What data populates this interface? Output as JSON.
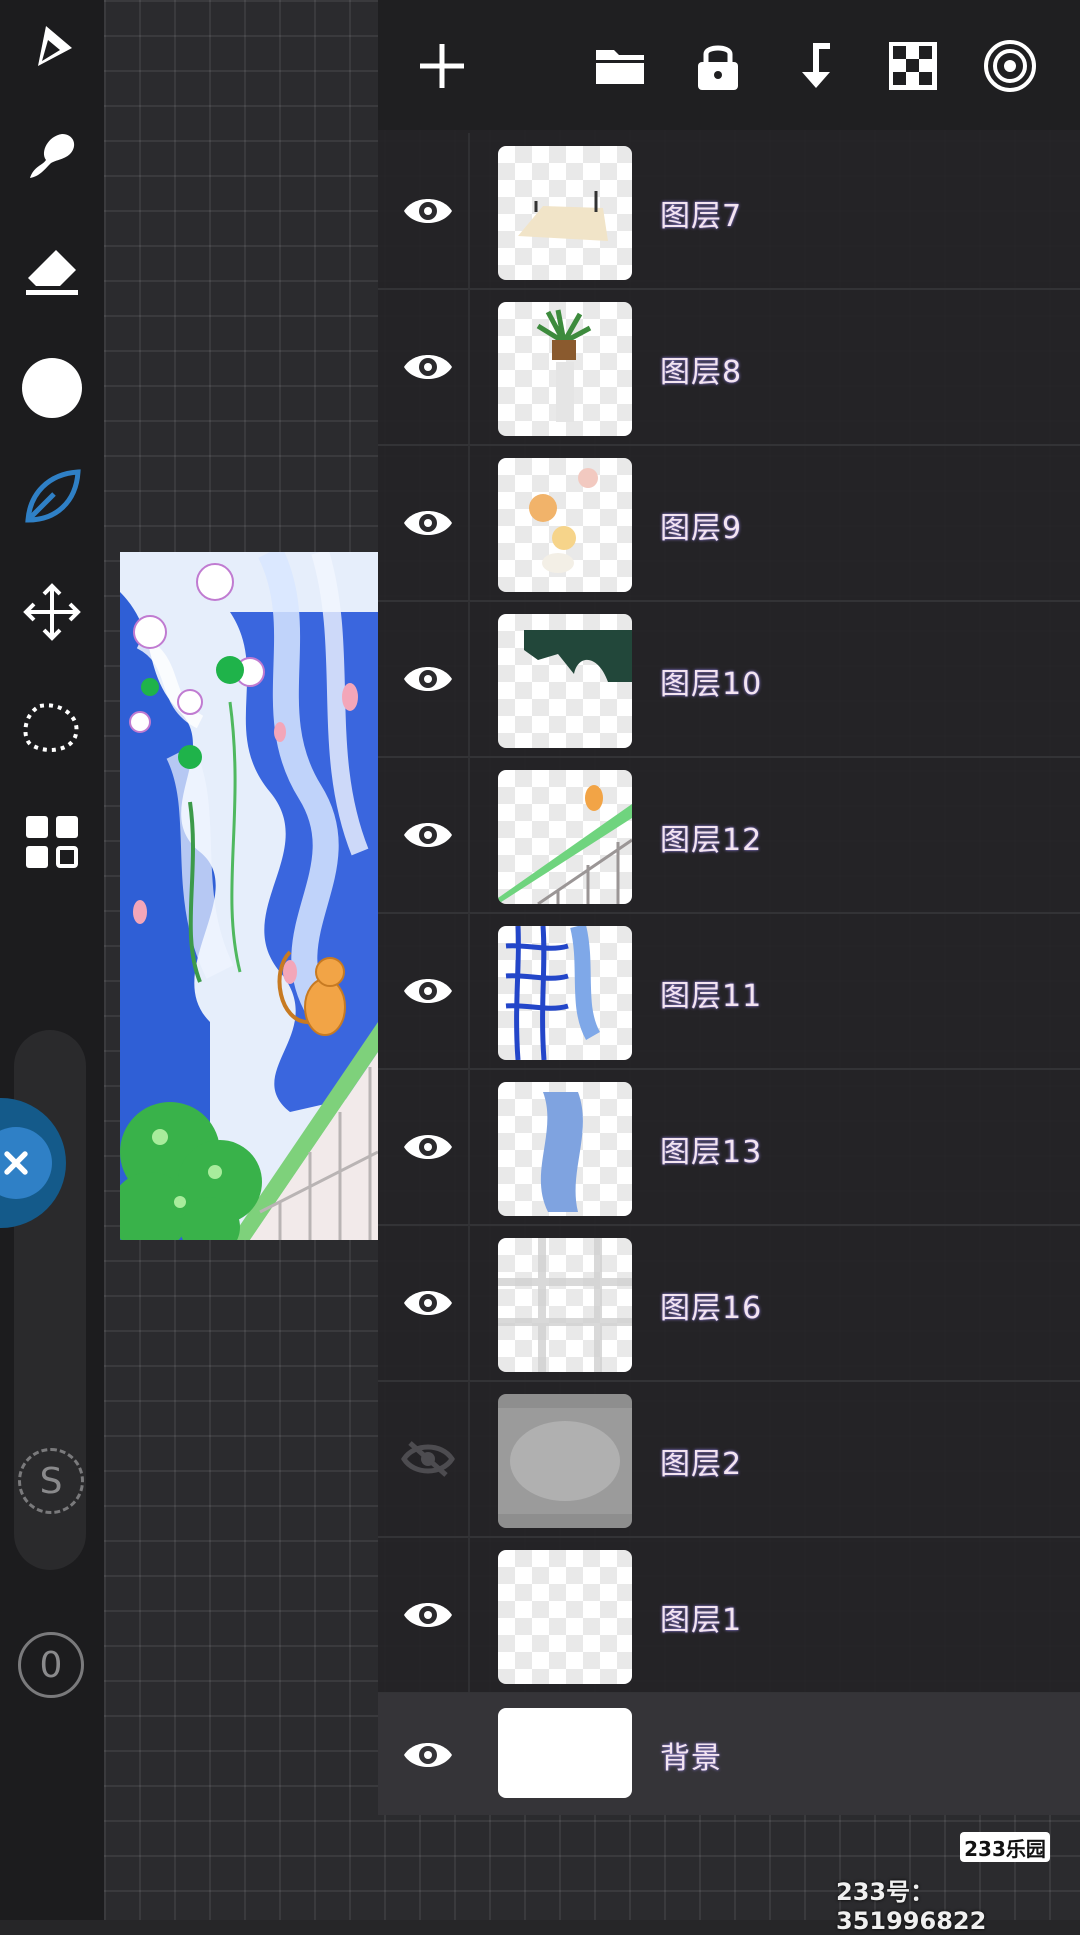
{
  "toolbar": {
    "tools": [
      "pencil-icon",
      "smudge-icon",
      "eraser-icon",
      "color-swatch",
      "leaf-brush-icon",
      "move-icon",
      "lasso-select-icon",
      "gallery-icon"
    ],
    "active_tool": "leaf-brush-icon",
    "accent_color": "#2f80c6",
    "size_label": "S",
    "opacity_value": "0"
  },
  "layer_panel": {
    "header_buttons": [
      "add-layer-icon",
      "folder-icon",
      "lock-icon",
      "merge-down-icon",
      "transparency-icon",
      "target-icon"
    ],
    "layers": [
      {
        "name": "图层7",
        "visible": true
      },
      {
        "name": "图层8",
        "visible": true
      },
      {
        "name": "图层9",
        "visible": true
      },
      {
        "name": "图层10",
        "visible": true
      },
      {
        "name": "图层12",
        "visible": true
      },
      {
        "name": "图层11",
        "visible": true
      },
      {
        "name": "图层13",
        "visible": true
      },
      {
        "name": "图层16",
        "visible": true
      },
      {
        "name": "图层2",
        "visible": false
      },
      {
        "name": "图层1",
        "visible": true
      }
    ],
    "background_layer": {
      "name": "背景",
      "visible": true
    }
  },
  "watermark": {
    "logo": "233乐园",
    "id_text": "233号：351996822"
  }
}
